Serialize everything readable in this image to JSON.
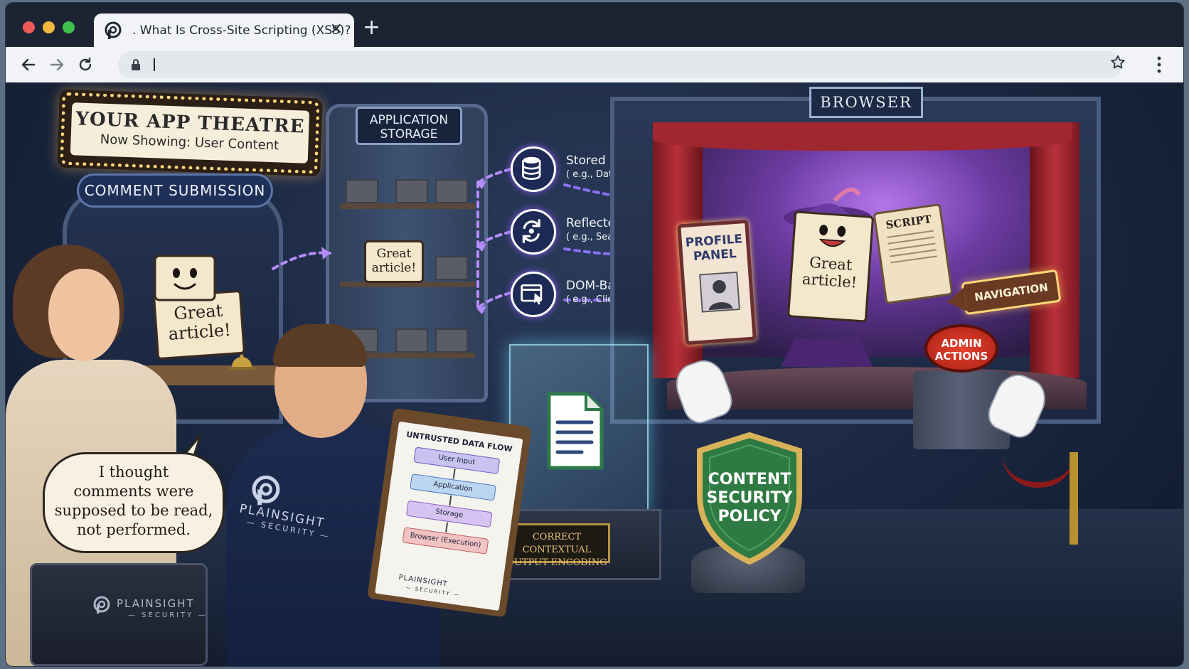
{
  "window": {
    "traffic_lights": {
      "close": "#ec5b57",
      "minimize": "#f2b73c",
      "zoom": "#3fbf4c"
    }
  },
  "tab": {
    "title": ". What Is Cross-Site Scripting (XSS)?",
    "close_symbol": "✕",
    "favicon": "plainsight-logo-icon"
  },
  "new_tab_symbol": "+",
  "toolbar": {
    "back_icon": "arrow-left-icon",
    "forward_icon": "arrow-right-icon",
    "reload_icon": "reload-icon",
    "address_value": "",
    "secure_icon": "lock-icon",
    "bookmark_icon": "star-icon",
    "menu_icon": "kebab-menu-icon"
  },
  "scene": {
    "marquee": {
      "title": "YOUR APP THEATRE",
      "subtitle": "Now Showing: User Content"
    },
    "booth_sign": "COMMENT SUBMISSION",
    "comment_card": {
      "line1": "Great",
      "line2": "article!"
    },
    "storage_sign": {
      "line1": "APPLICATION",
      "line2": "STORAGE"
    },
    "storage_card": {
      "line1": "Great",
      "line2": "article!"
    },
    "xss_types": [
      {
        "title": "Stored",
        "example": "( e.g., Database )",
        "icon": "database-icon"
      },
      {
        "title": "Reflected",
        "example": "( e.g., Search )",
        "icon": "refresh-cycle-icon"
      },
      {
        "title": "DOM-Based",
        "example": "( e.g., Client-Side )",
        "icon": "browser-cursor-icon"
      }
    ],
    "browser_sign": "BROWSER",
    "profile_panel": {
      "line1": "PROFILE",
      "line2": "PANEL"
    },
    "performer_card": {
      "line1": "Great",
      "line2": "article!"
    },
    "script_scroll": "SCRIPT",
    "navigation_sign": "NAVIGATION",
    "admin_button": {
      "line1": "ADMIN",
      "line2": "ACTIONS"
    },
    "encoding_plaque": {
      "line1": "CORRECT CONTEXTUAL",
      "line2": "OUTPUT ENCODING"
    },
    "csp_shield": {
      "line1": "CONTENT",
      "line2": "SECURITY",
      "line3": "POLICY"
    },
    "speech_bubble": {
      "line1": "I thought",
      "line2": "comments were",
      "line3": "supposed to be read,",
      "line4": "not performed."
    },
    "clipboard": {
      "title": "UNTRUSTED DATA FLOW",
      "steps": [
        "User Input",
        "Application",
        "Storage",
        "Browser (Execution)"
      ],
      "brand": "PLAINSIGHT",
      "brand_sub": "— SECURITY —"
    },
    "shirt_brand": {
      "name": "PLAINSIGHT",
      "sub": "— SECURITY —"
    },
    "case_brand": {
      "name": "PLAINSIGHT",
      "sub": "— SECURITY —"
    },
    "colors": {
      "arrow": "#b58cff",
      "stage_light": "#b476ec",
      "shield": "#2f7a43",
      "shield_border": "#d8b258",
      "marquee_bulbs": "#ffd77a"
    }
  }
}
